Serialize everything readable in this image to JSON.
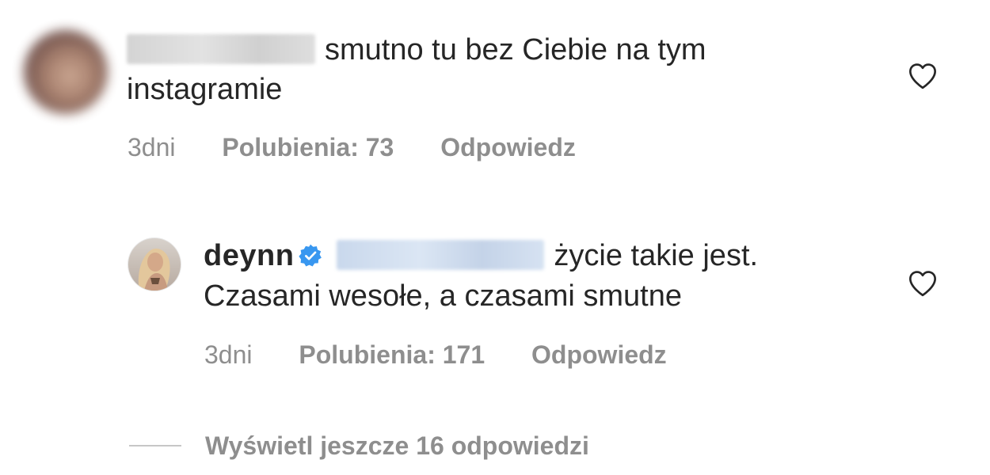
{
  "comments": [
    {
      "text": "smutno tu bez Ciebie na tym instagramie",
      "time": "3dni",
      "likes": "Polubienia: 73",
      "reply": "Odpowiedz"
    },
    {
      "username": "deynn",
      "text": "życie takie jest. Czasami wesołe, a czasami smutne",
      "time": "3dni",
      "likes": "Polubienia: 171",
      "reply": "Odpowiedz"
    }
  ],
  "view_more": {
    "label": "Wyświetl jeszcze 16 odpowiedzi"
  },
  "colors": {
    "text": "#262626",
    "meta": "#8e8e8e",
    "verified": "#3897f0"
  },
  "icons": {
    "like": "heart-outline-icon",
    "verified": "verified-badge-icon"
  }
}
